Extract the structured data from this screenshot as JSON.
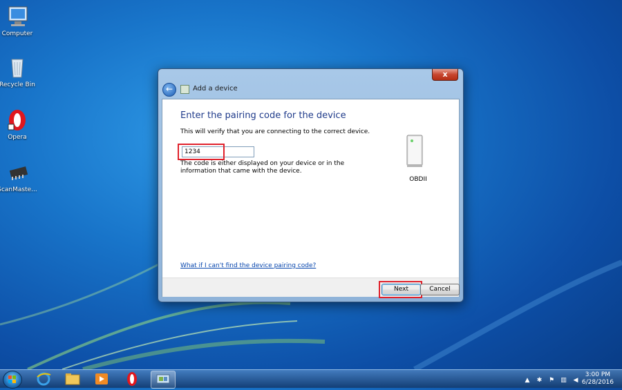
{
  "desktop": {
    "icons": [
      {
        "label": "Computer",
        "icon": "computer-icon"
      },
      {
        "label": "Recycle Bin",
        "icon": "recycle-bin-icon"
      },
      {
        "label": "Opera",
        "icon": "opera-icon"
      },
      {
        "label": "ScanMaste...",
        "icon": "scanmaster-icon"
      }
    ]
  },
  "dialog": {
    "title": "Add a device",
    "close_label": "x",
    "back_label": "←",
    "heading": "Enter the pairing code for the device",
    "description": "This will verify that you are connecting to the correct device.",
    "code_value": "1234",
    "hint": "The code is either displayed on your device or in the information that came with the device.",
    "device_name": "OBDII",
    "help_link": "What if I can't find the device pairing code?",
    "next_label": "Next",
    "cancel_label": "Cancel"
  },
  "taskbar": {
    "pinned": [
      "internet-explorer-icon",
      "file-explorer-icon",
      "media-player-icon",
      "opera-icon",
      "devices-icon"
    ],
    "tray_icons": [
      "show-hidden-icon",
      "bluetooth-icon",
      "action-center-icon",
      "network-icon",
      "volume-icon"
    ],
    "time": "3:00 PM",
    "date": "6/28/2016"
  },
  "colors": {
    "accent": "#1e3a8a",
    "highlight": "#e0202a",
    "link": "#0645ad"
  }
}
